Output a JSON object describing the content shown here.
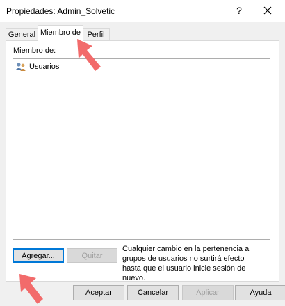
{
  "window": {
    "title": "Propiedades: Admin_Solvetic",
    "help_glyph": "?"
  },
  "tabs": [
    {
      "label": "General"
    },
    {
      "label": "Miembro de"
    },
    {
      "label": "Perfil"
    }
  ],
  "members": {
    "label": "Miembro de:",
    "items": [
      {
        "name": "Usuarios",
        "icon": "group-users-icon"
      }
    ]
  },
  "actions": {
    "add_label": "Agregar...",
    "remove_label": "Quitar",
    "note": "Cualquier cambio en la pertenencia a grupos de usuarios no surtirá efecto hasta que el usuario inicie sesión de nuevo."
  },
  "footer": {
    "accept": "Aceptar",
    "cancel": "Cancelar",
    "apply": "Aplicar",
    "help": "Ayuda"
  },
  "colors": {
    "focus_border": "#0078d7",
    "annotation_arrow": "#f26b6b"
  }
}
